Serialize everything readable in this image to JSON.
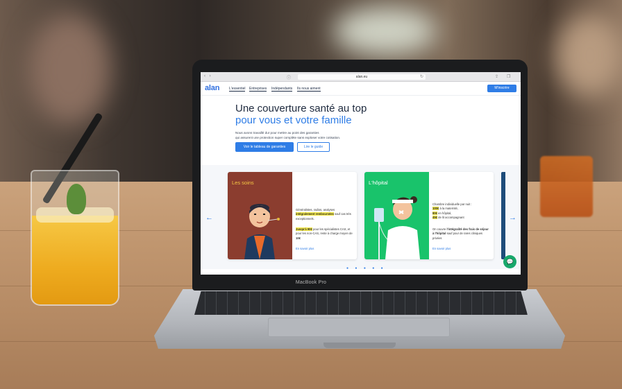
{
  "colors": {
    "brand": "#2f7de6",
    "card_soins": "#8b3d2f",
    "card_hopital": "#19c36b",
    "highlight": "#f4e94a"
  },
  "laptop": {
    "model_label": "MacBook Pro"
  },
  "browser": {
    "url": "alan.eu",
    "nav_icons": "‹ ›",
    "reader_icon": "ⓘ",
    "reload_icon": "↻",
    "share_icon": "⇪",
    "tabs_icon": "❐"
  },
  "site": {
    "logo": "alan",
    "nav": [
      "L'essentiel",
      "Entreprises",
      "Indépendants",
      "Ils nous aiment"
    ],
    "subscribe_label": "M'inscrire"
  },
  "hero": {
    "title": "Une couverture santé au top",
    "subtitle": "pour vous et votre famille",
    "description_1": "Nous avons travaillé dur pour mettre au point des garanties",
    "description_2": "qui assurent une protection super complète sans exploser votre cotisation.",
    "primary_button": "Voir le tableau de garanties",
    "secondary_button": "Lire le guide"
  },
  "carousel": {
    "left_arrow": "←",
    "right_arrow": "→",
    "cards": [
      {
        "title": "Les soins",
        "p1_a": "Généralistes, radios, analyses",
        "p1_hl": "intégralement remboursées",
        "p1_b": "sauf cas très exceptionnels.",
        "p2_hl": "Jusqu'à 90€",
        "p2_a": "pour les spécialistes CAS, et pour les non-CAS, reste à charge moyen de",
        "p2_bold": "10€",
        "more": "En savoir plus"
      },
      {
        "title": "L'hôpital",
        "p1": "Chambre individuelle par nuit :",
        "hl1": "100€",
        "hl1_rest": "à la maternité,",
        "hl2": "80€",
        "hl2_rest": "en hôpital,",
        "hl3": "45€",
        "hl3_rest": "de lit accompagnant",
        "p2_a": "On couvre",
        "p2_bold": "l'intégralité des frais de séjour à l'hôpital",
        "p2_b": "sauf pour de rares cliniques privées",
        "more": "En savoir plus"
      }
    ],
    "dots": "● ● ● ● ●",
    "chat_icon": "💬"
  }
}
